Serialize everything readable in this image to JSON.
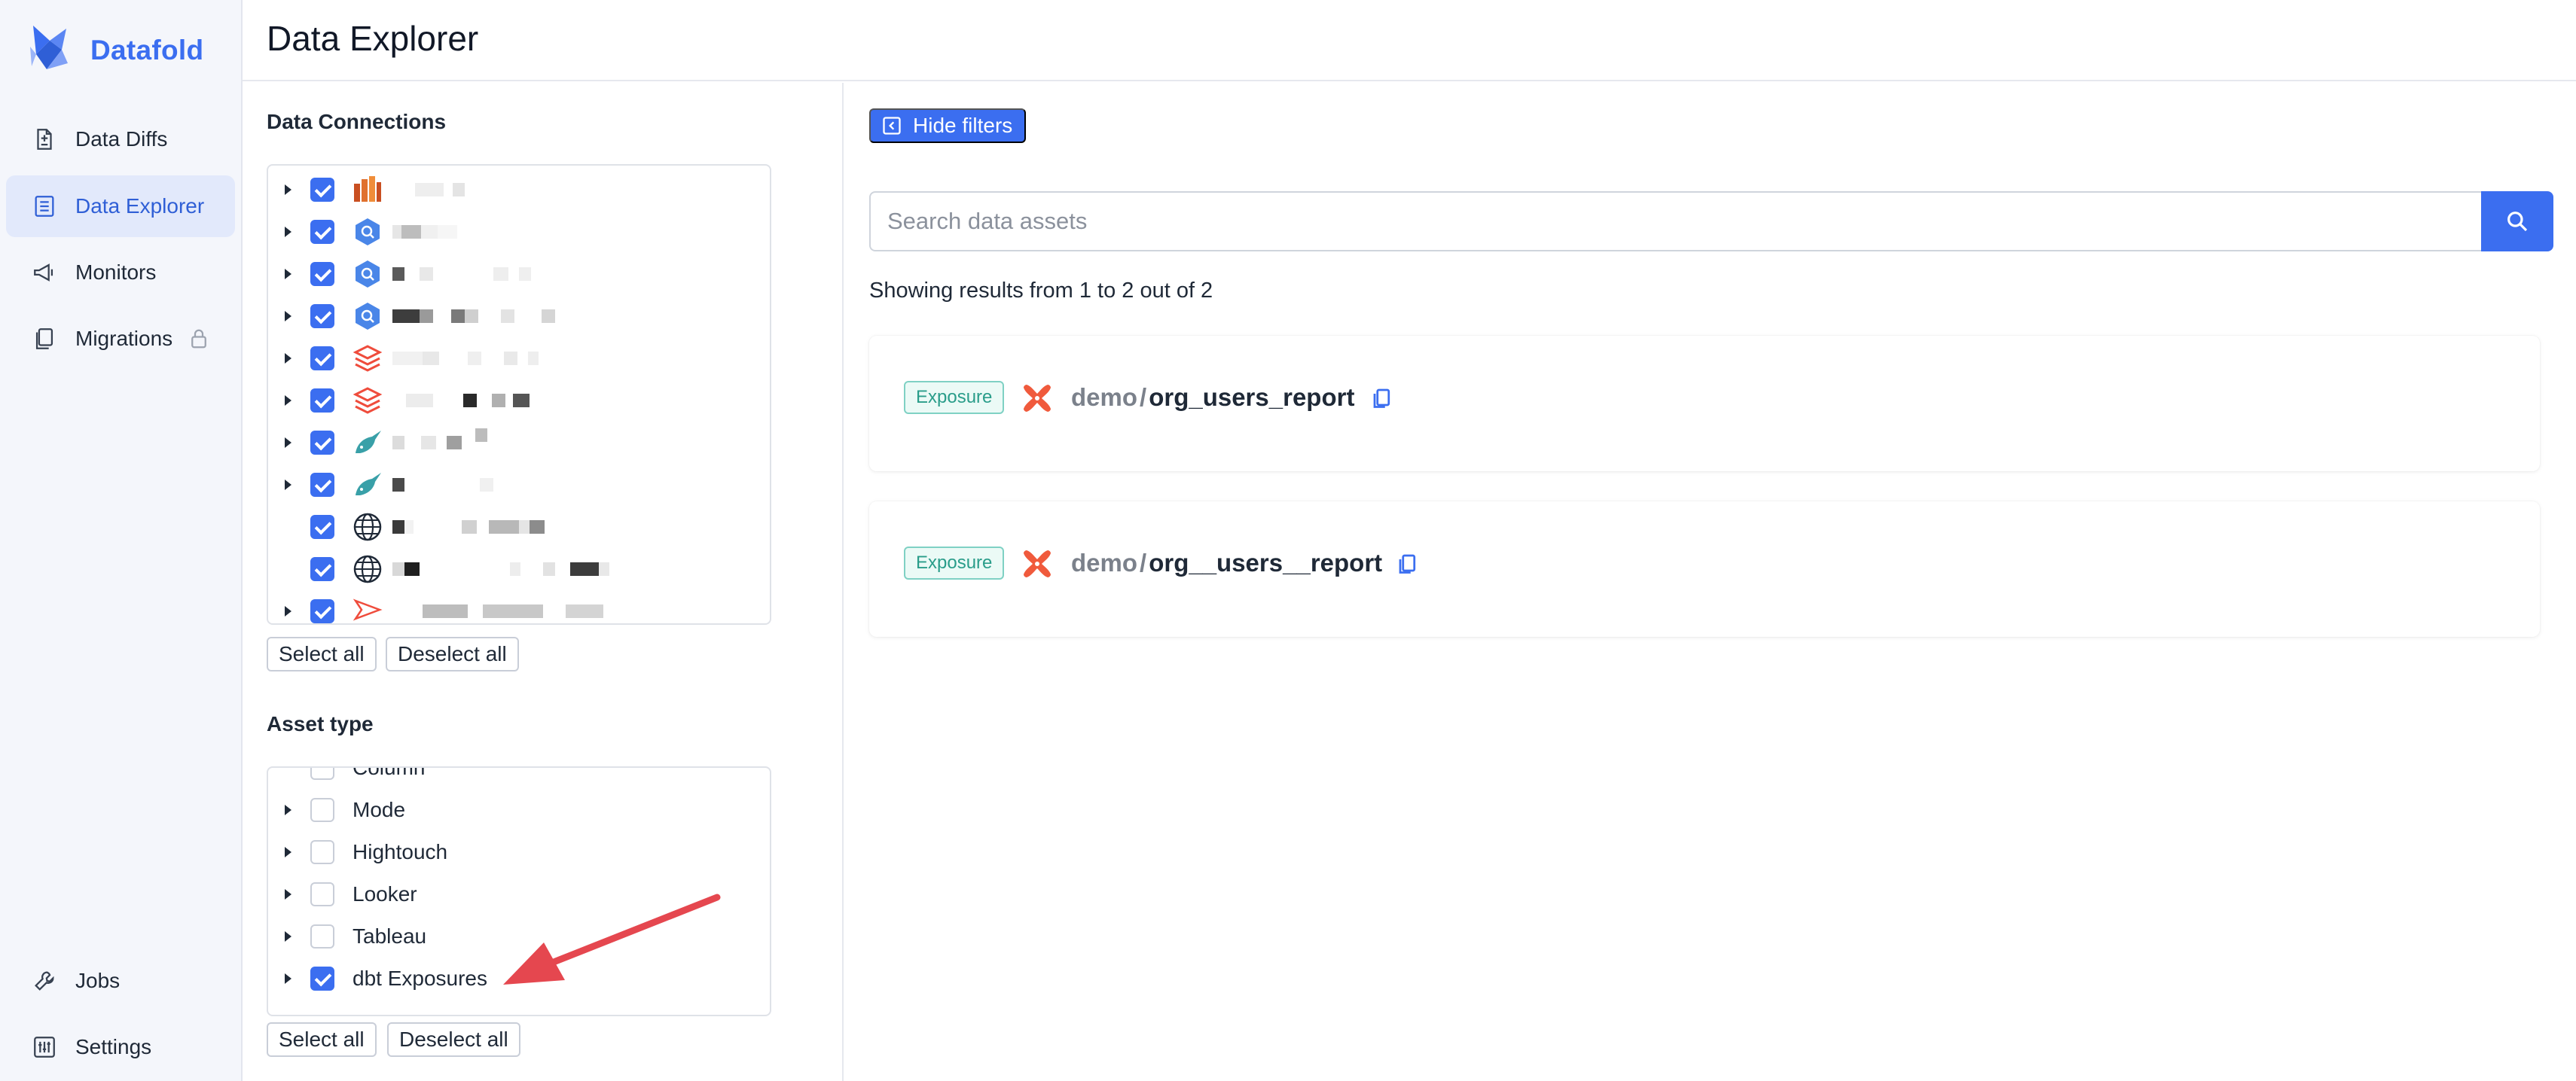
{
  "app": {
    "brand": "Datafold",
    "page_title": "Data Explorer"
  },
  "colors": {
    "accent": "#3b6ef0",
    "sidebar_bg": "#f4f6fb",
    "active_nav_bg": "#e2e9fb",
    "badge_text": "#2a9d8a",
    "annotation_arrow": "#e5474f"
  },
  "sidebar": {
    "items": [
      {
        "label": "Data Diffs",
        "icon": "document-diff-icon",
        "active": false
      },
      {
        "label": "Data Explorer",
        "icon": "list-box-icon",
        "active": true
      },
      {
        "label": "Monitors",
        "icon": "megaphone-icon",
        "active": false
      },
      {
        "label": "Migrations",
        "icon": "copy-pages-icon",
        "active": false,
        "locked": true
      }
    ],
    "bottom_items": [
      {
        "label": "Jobs",
        "icon": "wrench-icon"
      },
      {
        "label": "Settings",
        "icon": "sliders-icon"
      }
    ]
  },
  "filters": {
    "connections_title": "Data Connections",
    "connections": [
      {
        "icon": "redshift-icon",
        "checked": true,
        "expandable": true
      },
      {
        "icon": "bigquery-icon",
        "checked": true,
        "expandable": true
      },
      {
        "icon": "bigquery-icon",
        "checked": true,
        "expandable": true
      },
      {
        "icon": "bigquery-icon",
        "checked": true,
        "expandable": true
      },
      {
        "icon": "databricks-icon",
        "checked": true,
        "expandable": true
      },
      {
        "icon": "databricks-icon",
        "checked": true,
        "expandable": true
      },
      {
        "icon": "narwhal-icon",
        "checked": true,
        "expandable": true
      },
      {
        "icon": "narwhal-icon",
        "checked": true,
        "expandable": true
      },
      {
        "icon": "globe-icon",
        "checked": true,
        "expandable": false
      },
      {
        "icon": "globe-icon",
        "checked": true,
        "expandable": false
      },
      {
        "icon": "paper-plane-icon",
        "checked": true,
        "expandable": true
      }
    ],
    "select_all_label": "Select all",
    "deselect_all_label": "Deselect all",
    "asset_type_title": "Asset type",
    "asset_types": [
      {
        "label": "Column",
        "checked": false,
        "expandable": false
      },
      {
        "label": "Mode",
        "checked": false,
        "expandable": true
      },
      {
        "label": "Hightouch",
        "checked": false,
        "expandable": true
      },
      {
        "label": "Looker",
        "checked": false,
        "expandable": true
      },
      {
        "label": "Tableau",
        "checked": false,
        "expandable": true
      },
      {
        "label": "dbt Exposures",
        "checked": true,
        "expandable": true
      }
    ]
  },
  "main": {
    "hide_filters_label": "Hide filters",
    "search_placeholder": "Search data assets",
    "results_text": "Showing results from 1 to 2 out of 2",
    "results": [
      {
        "badge": "Exposure",
        "icon": "dbt-icon",
        "namespace": "demo",
        "separator": "/",
        "name": "org_users_report"
      },
      {
        "badge": "Exposure",
        "icon": "dbt-icon",
        "namespace": "demo",
        "separator": "/",
        "name": "org__users__report"
      }
    ]
  }
}
